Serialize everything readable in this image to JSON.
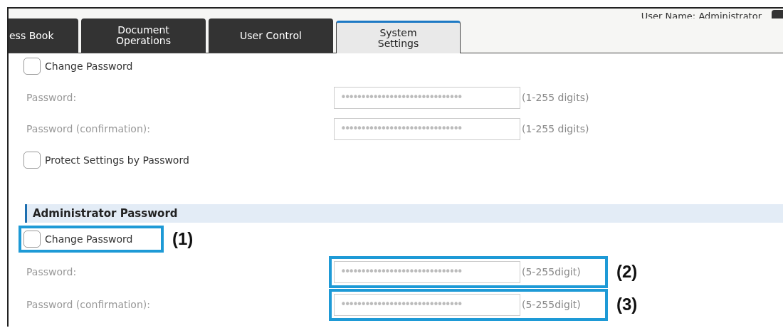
{
  "header": {
    "user_name": "User Name: Administrator"
  },
  "tabs": [
    {
      "label": "ess Book",
      "selected": false
    },
    {
      "label": "Document\nOperations",
      "selected": false
    },
    {
      "label": "User Control",
      "selected": false
    },
    {
      "label": "System\nSettings",
      "selected": true
    }
  ],
  "sections": [
    {
      "items": [
        {
          "kind": "checkbox",
          "label": "Change Password",
          "checked": false
        },
        {
          "kind": "password",
          "label": "Password:",
          "value": "••••••••••••••••••••••••••••••",
          "hint": "(1-255 digits)"
        },
        {
          "kind": "password",
          "label": "Password (confirmation):",
          "value": "••••••••••••••••••••••••••••••",
          "hint": "(1-255 digits)"
        },
        {
          "kind": "checkbox",
          "label": "Protect Settings by Password",
          "checked": false
        }
      ]
    },
    {
      "title": "Administrator Password",
      "items": [
        {
          "kind": "checkbox",
          "label": "Change Password",
          "checked": false,
          "callout": "(1)"
        },
        {
          "kind": "password",
          "label": "Password:",
          "value": "••••••••••••••••••••••••••••••",
          "hint": "(5-255digit)",
          "callout": "(2)"
        },
        {
          "kind": "password",
          "label": "Password (confirmation):",
          "value": "••••••••••••••••••••••••••••••",
          "hint": "(5-255digit)",
          "callout": "(3)"
        }
      ]
    }
  ]
}
